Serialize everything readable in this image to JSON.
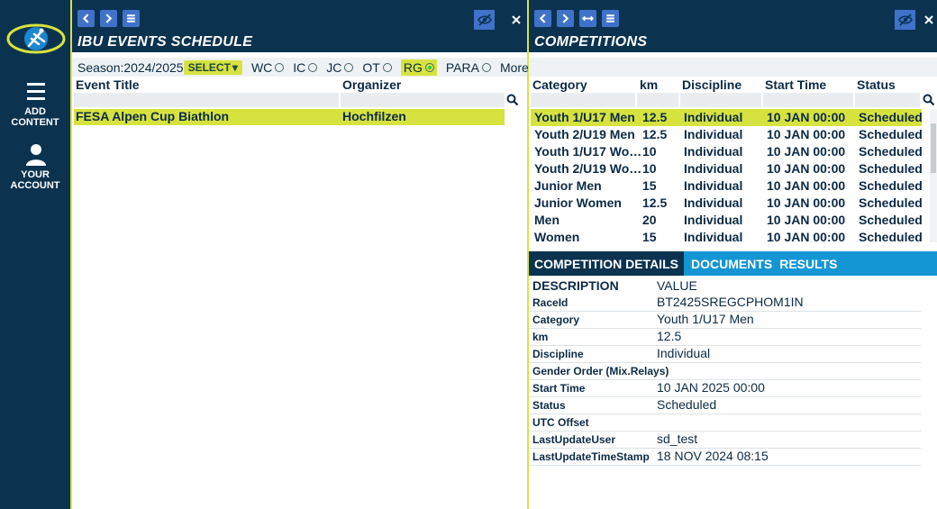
{
  "left_panel": {
    "title": "IBU EVENTS SCHEDULE",
    "season_label": "Season:",
    "season_value": "2024/2025",
    "select_label": "SELECT",
    "filters": [
      "WC",
      "IC",
      "JC",
      "OT",
      "RG",
      "PARA"
    ],
    "active_filter": "RG",
    "more_label": "More",
    "columns": [
      "Event Title",
      "Organizer"
    ],
    "rows": [
      {
        "event": "FESA Alpen Cup Biathlon",
        "organizer": "Hochfilzen"
      }
    ]
  },
  "right_panel": {
    "title": "COMPETITIONS",
    "columns": [
      "Category",
      "km",
      "Discipline",
      "Start Time",
      "Status"
    ],
    "rows": [
      {
        "category": "Youth 1/U17 Men",
        "km": "12.5",
        "discipline": "Individual",
        "start": "10 JAN 00:00",
        "status": "Scheduled"
      },
      {
        "category": "Youth 2/U19 Men",
        "km": "12.5",
        "discipline": "Individual",
        "start": "10 JAN 00:00",
        "status": "Scheduled"
      },
      {
        "category": "Youth 1/U17 Wo…",
        "km": "10",
        "discipline": "Individual",
        "start": "10 JAN 00:00",
        "status": "Scheduled"
      },
      {
        "category": "Youth 2/U19 Wo…",
        "km": "10",
        "discipline": "Individual",
        "start": "10 JAN 00:00",
        "status": "Scheduled"
      },
      {
        "category": "Junior Men",
        "km": "15",
        "discipline": "Individual",
        "start": "10 JAN 00:00",
        "status": "Scheduled"
      },
      {
        "category": "Junior Women",
        "km": "12.5",
        "discipline": "Individual",
        "start": "10 JAN 00:00",
        "status": "Scheduled"
      },
      {
        "category": "Men",
        "km": "20",
        "discipline": "Individual",
        "start": "10 JAN 00:00",
        "status": "Scheduled"
      },
      {
        "category": "Women",
        "km": "15",
        "discipline": "Individual",
        "start": "10 JAN 00:00",
        "status": "Scheduled"
      }
    ],
    "tabs": [
      "COMPETITION DETAILS",
      "DOCUMENTS",
      "RESULTS"
    ],
    "details_header": {
      "description": "DESCRIPTION",
      "value": "VALUE"
    },
    "details": [
      {
        "label": "RaceId",
        "value": "BT2425SREGCPHOM1IN"
      },
      {
        "label": "Category",
        "value": "Youth 1/U17 Men"
      },
      {
        "label": "km",
        "value": "12.5"
      },
      {
        "label": "Discipline",
        "value": "Individual"
      },
      {
        "label": "Gender Order (Mix.Relays)",
        "value": ""
      },
      {
        "label": "Start Time",
        "value": "10 JAN 2025 00:00"
      },
      {
        "label": "Status",
        "value": "Scheduled"
      },
      {
        "label": "UTC Offset",
        "value": ""
      },
      {
        "label": "LastUpdateUser",
        "value": "sd_test"
      },
      {
        "label": "LastUpdateTimeStamp",
        "value": "18 NOV 2024 08:15"
      }
    ]
  },
  "sidebar": {
    "add_content": "ADD CONTENT",
    "your_account": "YOUR ACCOUNT"
  },
  "icons": {
    "back": "chevron-left-icon",
    "forward": "chevron-right-icon",
    "menu": "menu-icon",
    "expand": "expand-horizontal-icon",
    "hide": "eye-slash-icon",
    "close": "close-icon",
    "search": "search-icon",
    "user": "user-icon"
  },
  "colors": {
    "navy": "#0b3350",
    "accent": "#d6e33f",
    "button_blue": "#3f72c8",
    "tab_blue": "#1496d4"
  }
}
